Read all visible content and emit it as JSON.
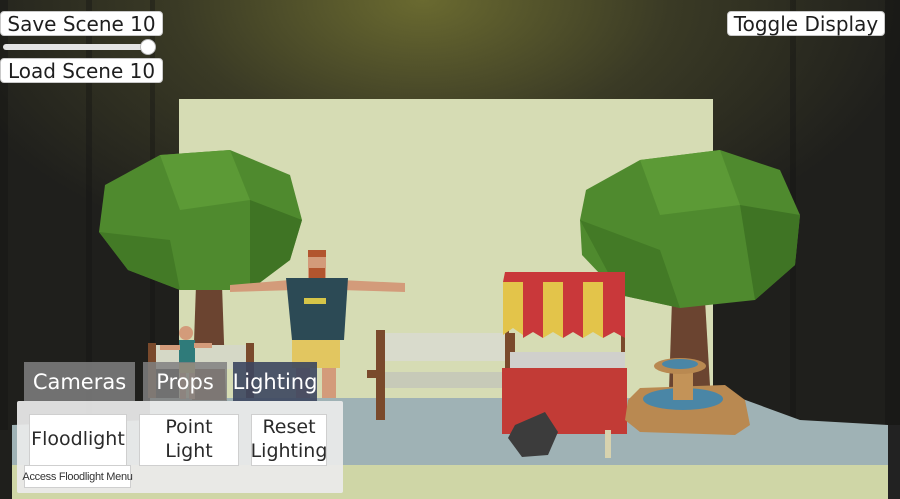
{
  "top_left": {
    "save_label": "Save Scene 10",
    "load_label": "Load Scene 10",
    "scene_slider_value": 1.0
  },
  "top_right": {
    "toggle_label": "Toggle Display"
  },
  "menu": {
    "tabs": [
      {
        "label": "Cameras",
        "active": false
      },
      {
        "label": "Props",
        "active": false
      },
      {
        "label": "Lighting",
        "active": true
      }
    ],
    "buttons": {
      "floodlight": "Floodlight",
      "point_light": "Point Light",
      "reset_line1": "Reset",
      "reset_line2": "Lighting",
      "access_floodlight": "Access Floodlight Menu"
    }
  },
  "colors": {
    "tab_active": "#3c465f",
    "tab_inactive": "#808080",
    "tree_foliage": "#4f8a2e",
    "awning_red": "#c9383a",
    "awning_yellow": "#e3c44a",
    "cart_body": "#c23b36",
    "floor": "#9fb2b5",
    "backdrop": "#d6dcb4"
  }
}
